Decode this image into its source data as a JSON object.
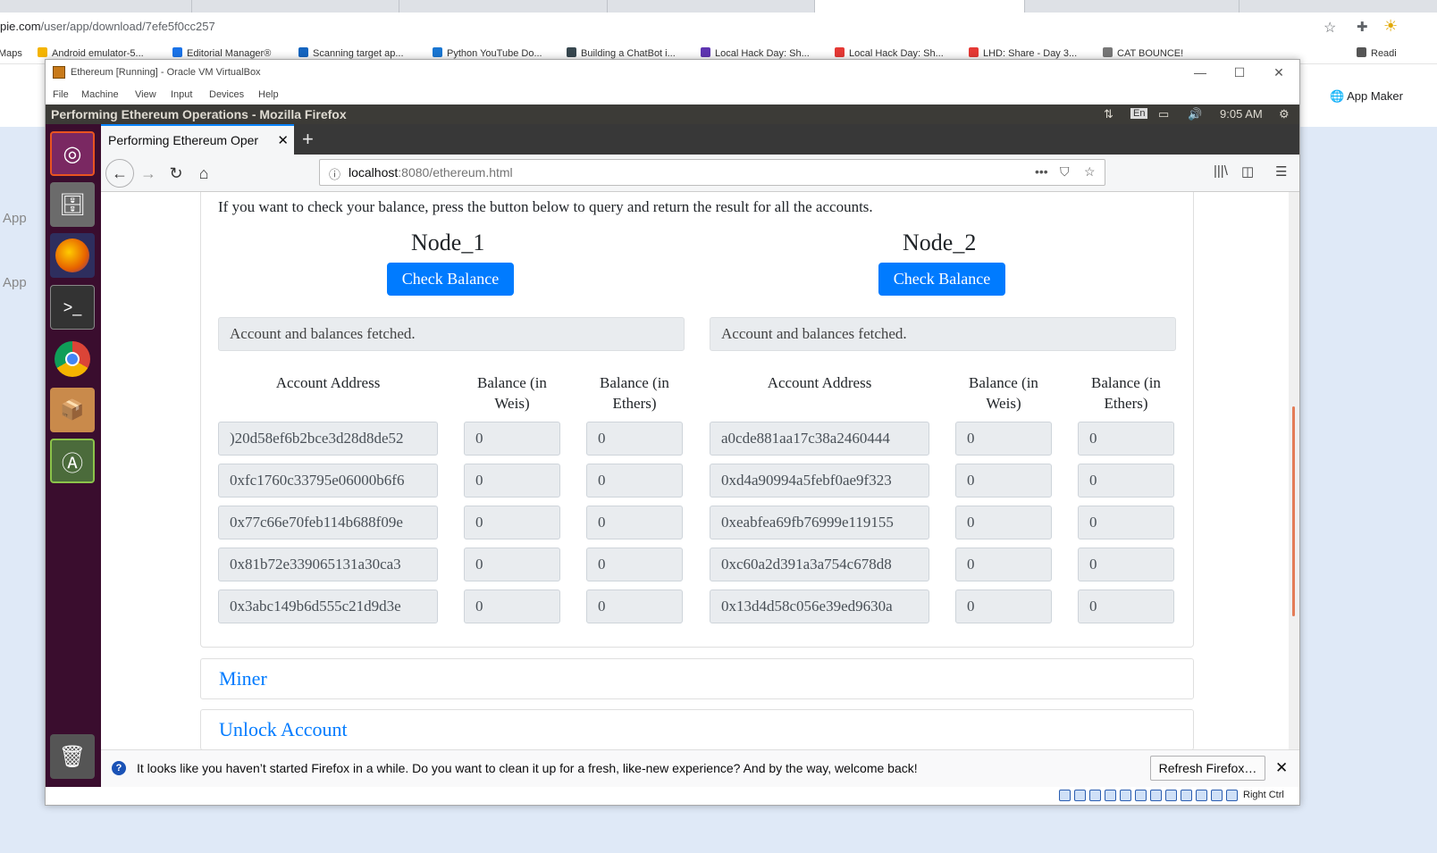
{
  "chrome": {
    "url_prefix": "pie.com",
    "url_rest": "/user/app/download/7efe5f0cc257",
    "bookmarks": [
      {
        "label": "Maps",
        "color": "#4caf50"
      },
      {
        "label": "Android emulator-5...",
        "color": "#f4b400"
      },
      {
        "label": "Editorial Manager®",
        "color": "#1a73e8"
      },
      {
        "label": "Scanning target ap...",
        "color": "#1565c0"
      },
      {
        "label": "Python YouTube Do...",
        "color": "#1976d2"
      },
      {
        "label": "Building a ChatBot i...",
        "color": "#37474f"
      },
      {
        "label": "Local Hack Day: Sh...",
        "color": "#5e35b1"
      },
      {
        "label": "Local Hack Day: Sh...",
        "color": "#e53935"
      },
      {
        "label": "LHD: Share - Day 3...",
        "color": "#e53935"
      },
      {
        "label": "CAT BOUNCE!",
        "color": "#777777"
      },
      {
        "label": "Readi",
        "color": "#555555"
      }
    ],
    "app_maker": "App Maker",
    "left_app": "App"
  },
  "vbox": {
    "title": "Ethereum [Running] - Oracle VM VirtualBox",
    "menu": [
      "File",
      "Machine",
      "View",
      "Input",
      "Devices",
      "Help"
    ],
    "status_right": "Right Ctrl"
  },
  "ubuntu": {
    "window_title": "Performing Ethereum Operations - Mozilla Firefox",
    "lang": "En",
    "time": "9:05 AM"
  },
  "firefox": {
    "tab_label": "Performing Ethereum Oper",
    "url_host": "localhost",
    "url_path": ":8080/ethereum.html",
    "notification": "It looks like you haven’t started Firefox in a while. Do you want to clean it up for a fresh, like-new experience? And by the way, welcome back!",
    "refresh_button": "Refresh Firefox…"
  },
  "page": {
    "intro": "If you want to check your balance, press the button below to query and return the result for all the accounts.",
    "nodes": [
      {
        "title": "Node_1",
        "button": "Check Balance",
        "alert": "Account and balances fetched.",
        "headers": {
          "address": "Account Address",
          "weis": "Balance (in Weis)",
          "ethers": "Balance (in Ethers)"
        },
        "rows": [
          {
            "address": ")20d58ef6b2bce3d28d8de52",
            "weis": "0",
            "ethers": "0"
          },
          {
            "address": "0xfc1760c33795e06000b6f6",
            "weis": "0",
            "ethers": "0"
          },
          {
            "address": "0x77c66e70feb114b688f09e",
            "weis": "0",
            "ethers": "0"
          },
          {
            "address": "0x81b72e339065131a30ca3",
            "weis": "0",
            "ethers": "0"
          },
          {
            "address": "0x3abc149b6d555c21d9d3e",
            "weis": "0",
            "ethers": "0"
          }
        ]
      },
      {
        "title": "Node_2",
        "button": "Check Balance",
        "alert": "Account and balances fetched.",
        "headers": {
          "address": "Account Address",
          "weis": "Balance (in Weis)",
          "ethers": "Balance (in Ethers)"
        },
        "rows": [
          {
            "address": "a0cde881aa17c38a2460444",
            "weis": "0",
            "ethers": "0"
          },
          {
            "address": "0xd4a90994a5febf0ae9f323",
            "weis": "0",
            "ethers": "0"
          },
          {
            "address": "0xeabfea69fb76999e119155",
            "weis": "0",
            "ethers": "0"
          },
          {
            "address": "0xc60a2d391a3a754c678d8",
            "weis": "0",
            "ethers": "0"
          },
          {
            "address": "0x13d4d58c056e39ed9630a",
            "weis": "0",
            "ethers": "0"
          }
        ]
      }
    ],
    "sections": [
      "Miner",
      "Unlock Account"
    ]
  }
}
